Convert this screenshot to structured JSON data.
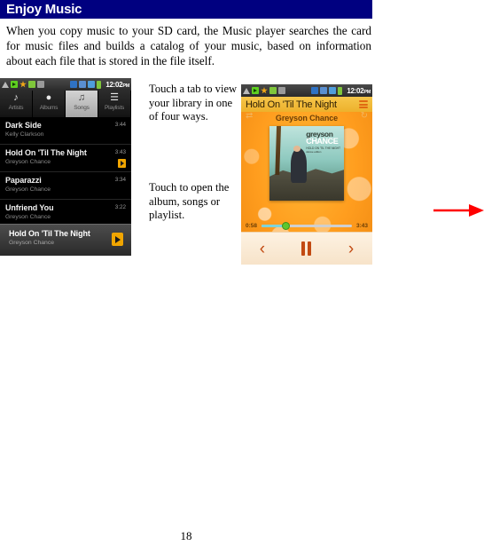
{
  "page": {
    "header_title": "Enjoy Music",
    "paragraph": "When you copy music to your SD card, the Music player searches the card for music files and builds a catalog of your music, based on information about each file that is stored in the file itself.",
    "page_number": "18",
    "header_bg_color": "#000080",
    "arrow_color": "#ff0000"
  },
  "callouts": {
    "tab_hint": "Touch a tab to view your library in one of four ways.",
    "open_hint": "Touch to open the album, songs or playlist."
  },
  "library_screen": {
    "statusbar": {
      "time": "12:02",
      "ampm": "PM",
      "icons_left": [
        "warning-icon",
        "play-icon",
        "star-icon",
        "usb-icon",
        "gps-icon"
      ],
      "icons_right": [
        "sd-card-icon",
        "download-icon",
        "sync-icon",
        "battery-icon"
      ]
    },
    "tabs": [
      {
        "label": "Artists",
        "glyph": "♩",
        "selected": false
      },
      {
        "label": "Albums",
        "glyph": "●",
        "selected": false
      },
      {
        "label": "Songs",
        "glyph": "♫",
        "selected": true
      },
      {
        "label": "Playlists",
        "glyph": "☰",
        "selected": false
      }
    ],
    "songs": [
      {
        "title": "Dark Side",
        "artist": "Kelly Clarkson",
        "duration": "3:44",
        "now_playing": false
      },
      {
        "title": "Hold On 'Til The Night",
        "artist": "Greyson Chance",
        "duration": "3:43",
        "now_playing": true
      },
      {
        "title": "Paparazzi",
        "artist": "Greyson Chance",
        "duration": "3:34",
        "now_playing": false
      },
      {
        "title": "Unfriend You",
        "artist": "Greyson Chance",
        "duration": "3:22",
        "now_playing": false
      }
    ],
    "now_playing_bar": {
      "title": "Hold On 'Til The Night",
      "artist": "Greyson Chance",
      "action_icon": "play-icon"
    }
  },
  "player_screen": {
    "statusbar": {
      "time": "12:02",
      "ampm": "PM"
    },
    "title": "Hold On 'Til The Night",
    "artist": "Greyson Chance",
    "menu_icon": "playlist-icon",
    "shuffle_icon": "shuffle-icon",
    "repeat_icon": "repeat-icon",
    "album_art": {
      "brand_line1": "greyson",
      "brand_line2": "CHANCE",
      "brand_line3": "HOLD ON 'TIL THE NIGHT",
      "brand_line4": "deluxe edition"
    },
    "elapsed": "0:58",
    "total": "3:43",
    "progress_percent": 27,
    "controls": {
      "previous": "‹",
      "pause": "pause-icon",
      "next": "›"
    }
  }
}
